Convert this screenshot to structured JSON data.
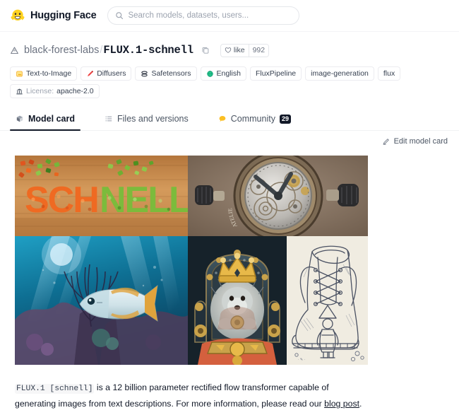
{
  "header": {
    "brand": "Hugging Face",
    "logo_icon": "hugging-face-emoji",
    "search_placeholder": "Search models, datasets, users...",
    "search_value": "",
    "search_icon": "search-icon"
  },
  "model": {
    "repo_type_icon": "model-icon",
    "owner": "black-forest-labs",
    "separator": "/",
    "name": "FLUX.1-schnell",
    "copy_icon": "copy-icon",
    "like_icon": "heart-icon",
    "like_label": "like",
    "like_count": "992"
  },
  "tags": [
    {
      "icon": "text-to-image-icon",
      "label": "Text-to-Image"
    },
    {
      "icon": "diffusers-icon",
      "label": "Diffusers"
    },
    {
      "icon": "safetensors-icon",
      "label": "Safetensors"
    },
    {
      "icon": "globe-icon",
      "label": "English"
    },
    {
      "icon": "",
      "label": "FluxPipeline"
    },
    {
      "icon": "",
      "label": "image-generation"
    },
    {
      "icon": "",
      "label": "flux"
    }
  ],
  "license": {
    "icon": "license-bank-icon",
    "label": "License:",
    "value": "apache-2.0"
  },
  "tabs": [
    {
      "icon": "model-card-icon",
      "label": "Model card",
      "active": true,
      "badge": ""
    },
    {
      "icon": "files-icon",
      "label": "Files and versions",
      "active": false,
      "badge": ""
    },
    {
      "icon": "community-icon",
      "label": "Community",
      "active": false,
      "badge": "29"
    }
  ],
  "edit": {
    "icon": "pencil-icon",
    "label": "Edit model card"
  },
  "gallery": {
    "images": [
      {
        "name": "schnell-vegetables-image",
        "alt": "The word SCHNELL spelled out in chopped orange and green vegetables on a wooden cutting board"
      },
      {
        "name": "watch-movement-image",
        "alt": "Close-up of a skeleton mechanical watch movement showing brass gears and crowns"
      },
      {
        "name": "underwater-fish-image",
        "alt": "Underwater coral reef scene with a fish and sun rays filtering through blue water"
      },
      {
        "name": "crowned-hedgehog-image",
        "alt": "A hedgehog wearing a golden crown seated on an ornate throne with red drapery"
      },
      {
        "name": "boot-sketch-image",
        "alt": "Pencil sketch of a giant laced boot with a small figure in a pointed hat standing beside it"
      }
    ]
  },
  "description": {
    "code_1": "FLUX.1 [schnell]",
    "text_1": " is a 12 billion parameter rectified flow transformer capable of generating images from text descriptions. For more information, please read our ",
    "link_text": "blog post",
    "text_2": "."
  },
  "colors": {
    "accent": "#111827",
    "muted": "#6b7280",
    "border": "#e5e7eb",
    "brand_yellow": "#ffd21e"
  }
}
